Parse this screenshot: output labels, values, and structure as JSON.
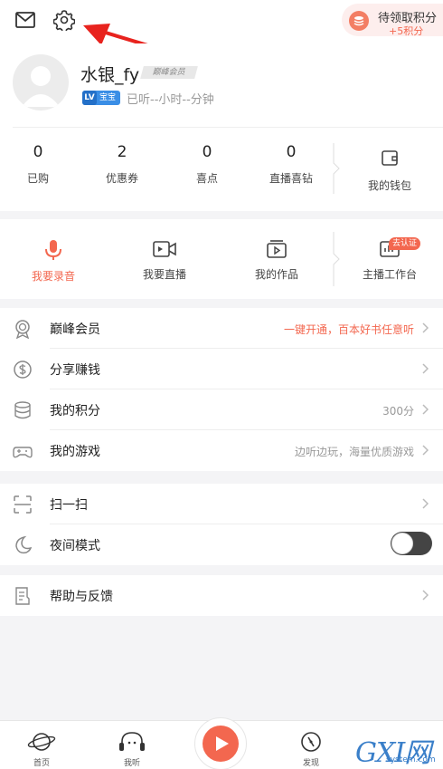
{
  "header": {
    "mail_icon": "mail-icon",
    "settings_icon": "gear-icon",
    "points_pill": {
      "title": "待领取积分",
      "subtitle": "+5积分"
    }
  },
  "profile": {
    "username": "水银_fy",
    "vip_tag": "巅峰会员",
    "level_badge": {
      "lv": "LV",
      "name": "宝宝"
    },
    "listen_time": "已听--小时--分钟"
  },
  "stats": [
    {
      "value": "0",
      "label": "已购"
    },
    {
      "value": "2",
      "label": "优惠券"
    },
    {
      "value": "0",
      "label": "喜点"
    },
    {
      "value": "0",
      "label": "直播喜钻"
    }
  ],
  "wallet": {
    "label": "我的钱包"
  },
  "tools": [
    {
      "label": "我要录音",
      "icon": "mic-icon",
      "active": true
    },
    {
      "label": "我要直播",
      "icon": "live-camera-icon"
    },
    {
      "label": "我的作品",
      "icon": "works-icon"
    },
    {
      "label": "主播工作台",
      "icon": "studio-icon",
      "tag": "去认证"
    }
  ],
  "menu_group_1": [
    {
      "label": "巅峰会员",
      "value": "一键开通，百本好书任意听",
      "icon": "medal-icon"
    },
    {
      "label": "分享赚钱",
      "value": "",
      "icon": "dollar-icon"
    },
    {
      "label": "我的积分",
      "value": "300分",
      "icon": "coins-icon"
    },
    {
      "label": "我的游戏",
      "value": "边听边玩，海量优质游戏",
      "icon": "gamepad-icon"
    }
  ],
  "menu_group_2": [
    {
      "label": "扫一扫",
      "icon": "scan-icon"
    },
    {
      "label": "夜间模式",
      "icon": "moon-icon",
      "toggle": false
    }
  ],
  "menu_group_3": [
    {
      "label": "帮助与反馈",
      "icon": "feedback-icon"
    }
  ],
  "tabbar": [
    {
      "label": "首页",
      "icon": "planet-icon"
    },
    {
      "label": "我听",
      "icon": "headphones-icon"
    },
    {
      "label": "",
      "icon": "play-icon"
    },
    {
      "label": "发现",
      "icon": "compass-icon"
    }
  ],
  "watermark": {
    "text": "GXI网",
    "url": "system.com"
  },
  "colors": {
    "accent": "#f3674f",
    "badge_blue": "#3a8ee6",
    "background": "#f4f4f6"
  }
}
